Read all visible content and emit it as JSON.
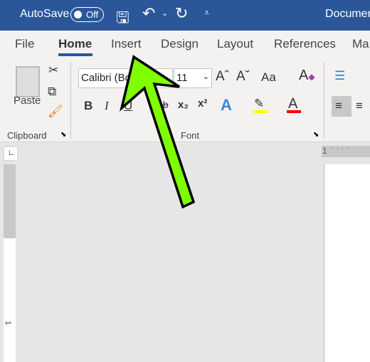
{
  "titlebar": {
    "autosave_label": "AutoSave",
    "autosave_state": "Off",
    "doc_title": "Documen"
  },
  "tabs": [
    {
      "label": "File"
    },
    {
      "label": "Home",
      "active": true
    },
    {
      "label": "Insert"
    },
    {
      "label": "Design"
    },
    {
      "label": "Layout"
    },
    {
      "label": "References"
    },
    {
      "label": "Ma"
    }
  ],
  "ribbon": {
    "clipboard": {
      "paste_label": "Paste",
      "group_label": "Clipboard"
    },
    "font": {
      "font_name": "Calibri (Bo",
      "font_size": "11",
      "change_case": "Aa",
      "bold": "B",
      "italic": "I",
      "underline": "U",
      "strike": "ab",
      "subscript": "x₂",
      "superscript": "x²",
      "text_effects": "A",
      "font_color": "A",
      "group_label": "Font"
    }
  },
  "ruler": {
    "horizontal_label": "1",
    "vertical_label": "1"
  },
  "colors": {
    "titlebar": "#2b579a",
    "arrow": "#7fff00",
    "highlight": "#ffff00",
    "font_color": "#ff0000"
  }
}
